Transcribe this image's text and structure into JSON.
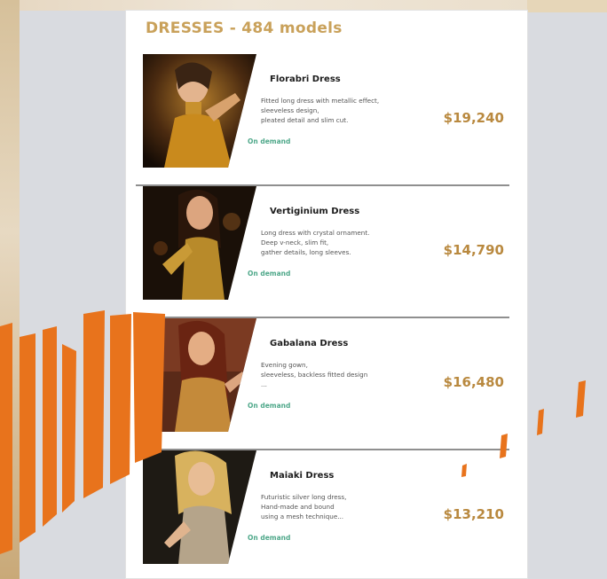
{
  "catalog": {
    "title": "DRESSES - 484 models"
  },
  "products": [
    {
      "name": "Florabri Dress",
      "description": [
        "Fitted long dress with metallic effect,",
        "sleeveless design,",
        "pleated detail and slim cut."
      ],
      "status": "On demand",
      "price": "$19,240"
    },
    {
      "name": "Vertiginium Dress",
      "description": [
        "Long dress with crystal ornament.",
        "Deep v-neck, slim fit,",
        "gather details, long sleeves."
      ],
      "status": "On demand",
      "price": "$14,790"
    },
    {
      "name": "Gabalana Dress",
      "description": [
        "Evening gown,",
        "sleeveless, backless fitted design",
        "..."
      ],
      "status": "On demand",
      "price": "$16,480"
    },
    {
      "name": "Maiaki Dress",
      "description": [
        "Futuristic silver long dress,",
        "Hand-made and bound",
        "using a mesh technique..."
      ],
      "status": "On demand",
      "price": "$13,210"
    }
  ],
  "colors": {
    "accent_gold": "#c9a15a",
    "price_gold": "#b9893f",
    "status_green": "#4fa88a",
    "overlay_orange": "#e8731c"
  }
}
